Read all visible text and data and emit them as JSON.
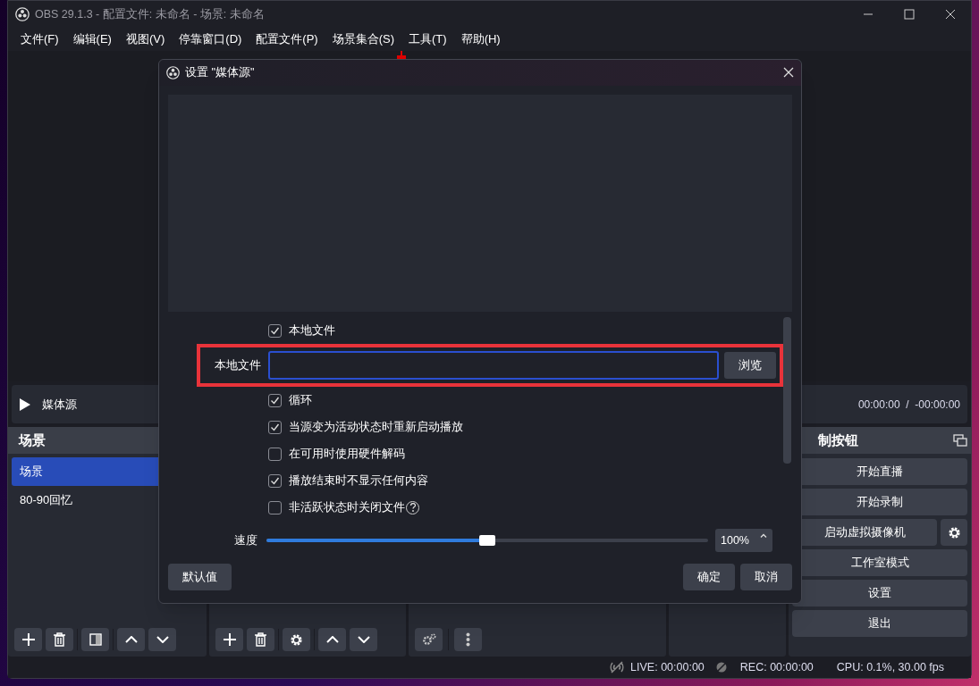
{
  "window": {
    "title": "OBS 29.1.3 - 配置文件: 未命名 - 场景: 未命名"
  },
  "menu": [
    "文件(F)",
    "编辑(E)",
    "视图(V)",
    "停靠窗口(D)",
    "配置文件(P)",
    "场景集合(S)",
    "工具(T)",
    "帮助(H)"
  ],
  "media_bar": {
    "name": "媒体源",
    "time": "00:00:00  /  -00:00:00"
  },
  "scenes": {
    "title": "场景",
    "items": [
      {
        "label": "场景",
        "selected": true
      },
      {
        "label": "80-90回忆",
        "selected": false
      }
    ]
  },
  "controls": {
    "title": "制按钮",
    "buttons": [
      {
        "label": "开始直播",
        "settings": false
      },
      {
        "label": "开始录制",
        "settings": false
      },
      {
        "label": "启动虚拟摄像机",
        "settings": true
      },
      {
        "label": "工作室模式",
        "settings": false
      },
      {
        "label": "设置",
        "settings": false
      },
      {
        "label": "退出",
        "settings": false
      }
    ]
  },
  "status_bar": {
    "live": "LIVE: 00:00:00",
    "rec": "REC: 00:00:00",
    "cpu": "CPU: 0.1%, 30.00 fps"
  },
  "dialog": {
    "title": "设置 \"媒体源\"",
    "rows": [
      {
        "kind": "checkbox",
        "label": "本地文件",
        "checked": true,
        "help": false
      },
      {
        "kind": "file",
        "label": "本地文件",
        "button": "浏览",
        "highlighted": true
      },
      {
        "kind": "checkbox",
        "label": "循环",
        "checked": true,
        "help": false
      },
      {
        "kind": "checkbox",
        "label": "当源变为活动状态时重新启动播放",
        "checked": true,
        "help": false
      },
      {
        "kind": "checkbox",
        "label": "在可用时使用硬件解码",
        "checked": false,
        "help": false
      },
      {
        "kind": "checkbox",
        "label": "播放结束时不显示任何内容",
        "checked": true,
        "help": false
      },
      {
        "kind": "checkbox",
        "label": "非活跃状态时关闭文件",
        "checked": false,
        "help": true
      },
      {
        "kind": "slider",
        "label": "速度",
        "level": 0.5,
        "value": "100%"
      }
    ],
    "buttons": {
      "defaults": "默认值",
      "ok": "确定",
      "cancel": "取消"
    }
  }
}
